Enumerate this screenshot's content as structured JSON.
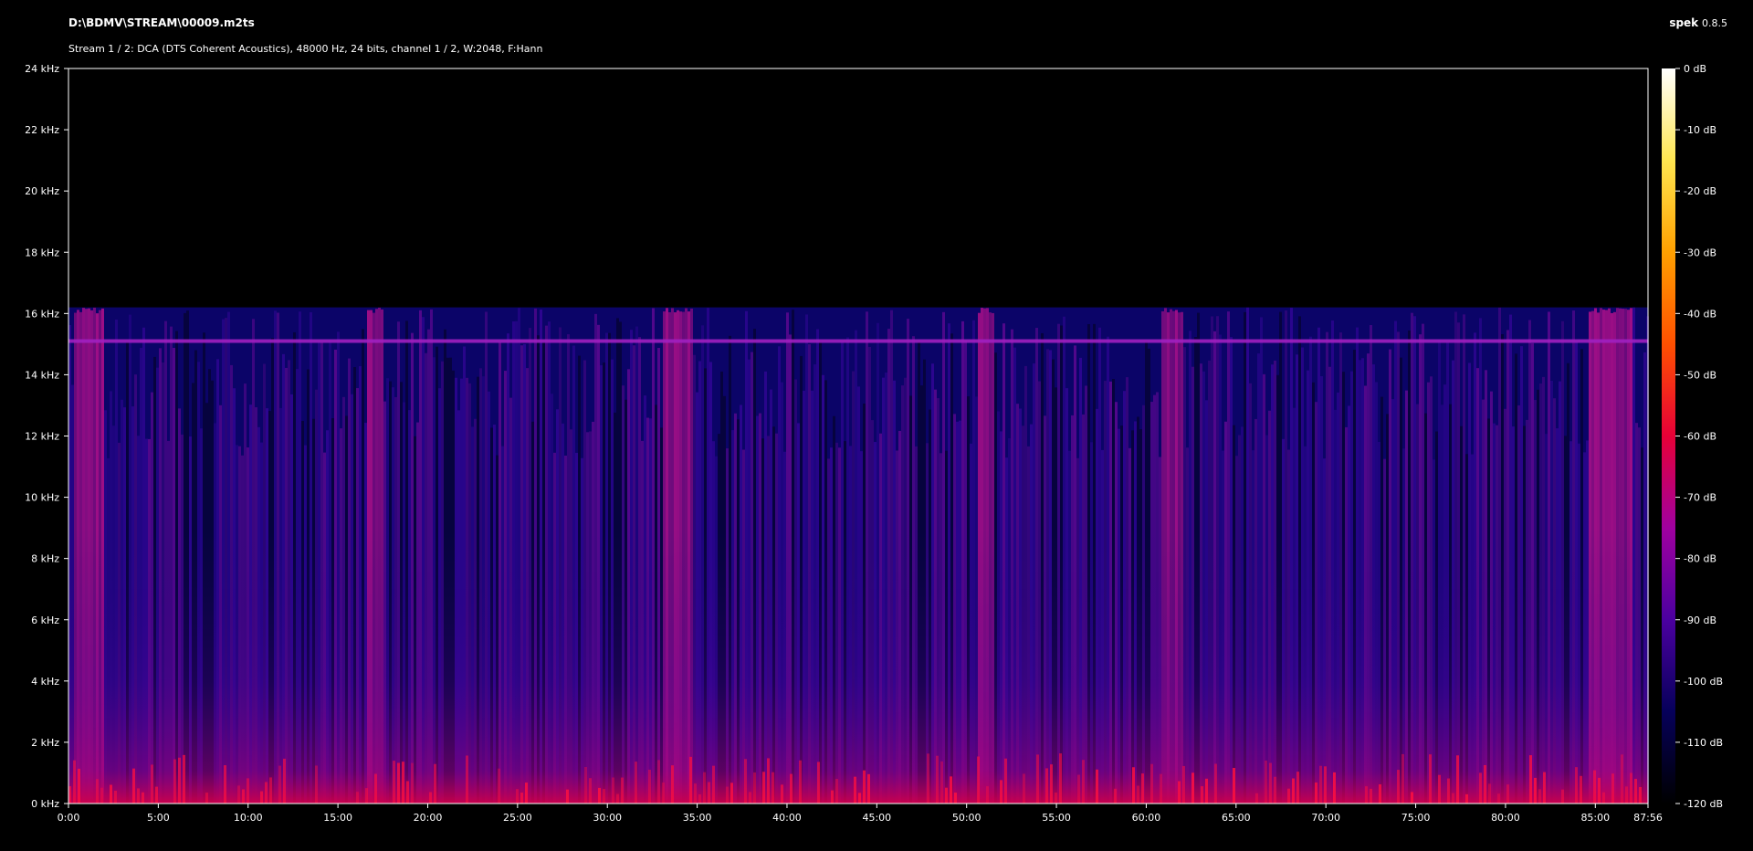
{
  "header": {
    "file_path": "D:\\BDMV\\STREAM\\00009.m2ts",
    "stream_info": "Stream 1 / 2: DCA (DTS Coherent Acoustics), 48000 Hz, 24 bits, channel 1 / 2, W:2048, F:Hann",
    "app_name": "spek",
    "app_version": "0.8.5"
  },
  "chart_data": {
    "type": "heatmap",
    "title": "",
    "xlabel": "",
    "ylabel": "",
    "x_unit": "time (m:ss)",
    "y_unit": "kHz",
    "xlim": [
      0,
      87.933
    ],
    "ylim": [
      0,
      24
    ],
    "x_ticks": [
      {
        "value": 0,
        "label": "0:00"
      },
      {
        "value": 5,
        "label": "5:00"
      },
      {
        "value": 10,
        "label": "10:00"
      },
      {
        "value": 15,
        "label": "15:00"
      },
      {
        "value": 20,
        "label": "20:00"
      },
      {
        "value": 25,
        "label": "25:00"
      },
      {
        "value": 30,
        "label": "30:00"
      },
      {
        "value": 35,
        "label": "35:00"
      },
      {
        "value": 40,
        "label": "40:00"
      },
      {
        "value": 45,
        "label": "45:00"
      },
      {
        "value": 50,
        "label": "50:00"
      },
      {
        "value": 55,
        "label": "55:00"
      },
      {
        "value": 60,
        "label": "60:00"
      },
      {
        "value": 65,
        "label": "65:00"
      },
      {
        "value": 70,
        "label": "70:00"
      },
      {
        "value": 75,
        "label": "75:00"
      },
      {
        "value": 80,
        "label": "80:00"
      },
      {
        "value": 85,
        "label": "85:00"
      },
      {
        "value": 87.933,
        "label": "87:56"
      }
    ],
    "y_ticks": [
      {
        "value": 0,
        "label": "0 kHz"
      },
      {
        "value": 2,
        "label": "2 kHz"
      },
      {
        "value": 4,
        "label": "4 kHz"
      },
      {
        "value": 6,
        "label": "6 kHz"
      },
      {
        "value": 8,
        "label": "8 kHz"
      },
      {
        "value": 10,
        "label": "10 kHz"
      },
      {
        "value": 12,
        "label": "12 kHz"
      },
      {
        "value": 14,
        "label": "14 kHz"
      },
      {
        "value": 16,
        "label": "16 kHz"
      },
      {
        "value": 18,
        "label": "18 kHz"
      },
      {
        "value": 20,
        "label": "20 kHz"
      },
      {
        "value": 22,
        "label": "22 kHz"
      },
      {
        "value": 24,
        "label": "24 kHz"
      }
    ],
    "colorbar": {
      "range_db": [
        -120,
        0
      ],
      "ticks": [
        {
          "value": 0,
          "label": "0 dB"
        },
        {
          "value": -10,
          "label": "-10 dB"
        },
        {
          "value": -20,
          "label": "-20 dB"
        },
        {
          "value": -30,
          "label": "-30 dB"
        },
        {
          "value": -40,
          "label": "-40 dB"
        },
        {
          "value": -50,
          "label": "-50 dB"
        },
        {
          "value": -60,
          "label": "-60 dB"
        },
        {
          "value": -70,
          "label": "-70 dB"
        },
        {
          "value": -80,
          "label": "-80 dB"
        },
        {
          "value": -90,
          "label": "-90 dB"
        },
        {
          "value": -100,
          "label": "-100 dB"
        },
        {
          "value": -110,
          "label": "-110 dB"
        },
        {
          "value": -120,
          "label": "-120 dB"
        }
      ],
      "colors": [
        "#000000",
        "#06005a",
        "#4b00a0",
        "#a000a0",
        "#e60037",
        "#ff5000",
        "#ffa000",
        "#ffe650",
        "#ffffff"
      ]
    },
    "content_features": {
      "cutoff_khz": 16.2,
      "tone_line_khz": 15.1,
      "loud_segments_min": [
        [
          0.2,
          1.9
        ],
        [
          16.5,
          17.5
        ],
        [
          33.0,
          34.7
        ],
        [
          50.6,
          51.5
        ],
        [
          60.8,
          62.0
        ],
        [
          84.5,
          87.0
        ]
      ]
    }
  }
}
